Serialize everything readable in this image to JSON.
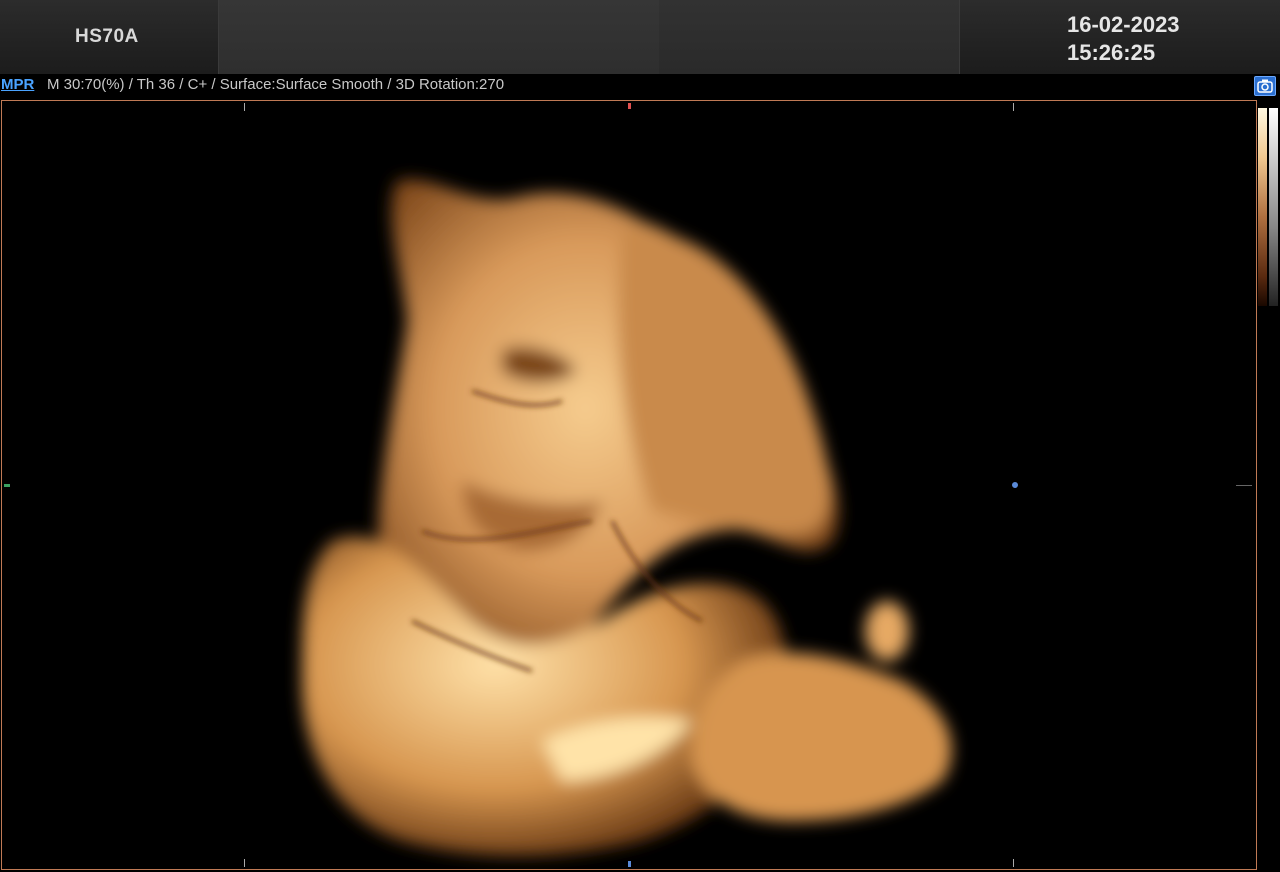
{
  "header": {
    "model": "HS70A",
    "date": "16-02-2023",
    "time": "15:26:25"
  },
  "infobar": {
    "mode_label": "MPR",
    "params": "M 30:70(%) / Th 36 / C+ / Surface:Surface Smooth / 3D Rotation:270"
  },
  "icons": {
    "camera": "camera-view-icon"
  },
  "colors": {
    "mode_label": "#4aa3ff",
    "viewport_border": "#c07a55",
    "render_tint": "#e9b06a"
  }
}
